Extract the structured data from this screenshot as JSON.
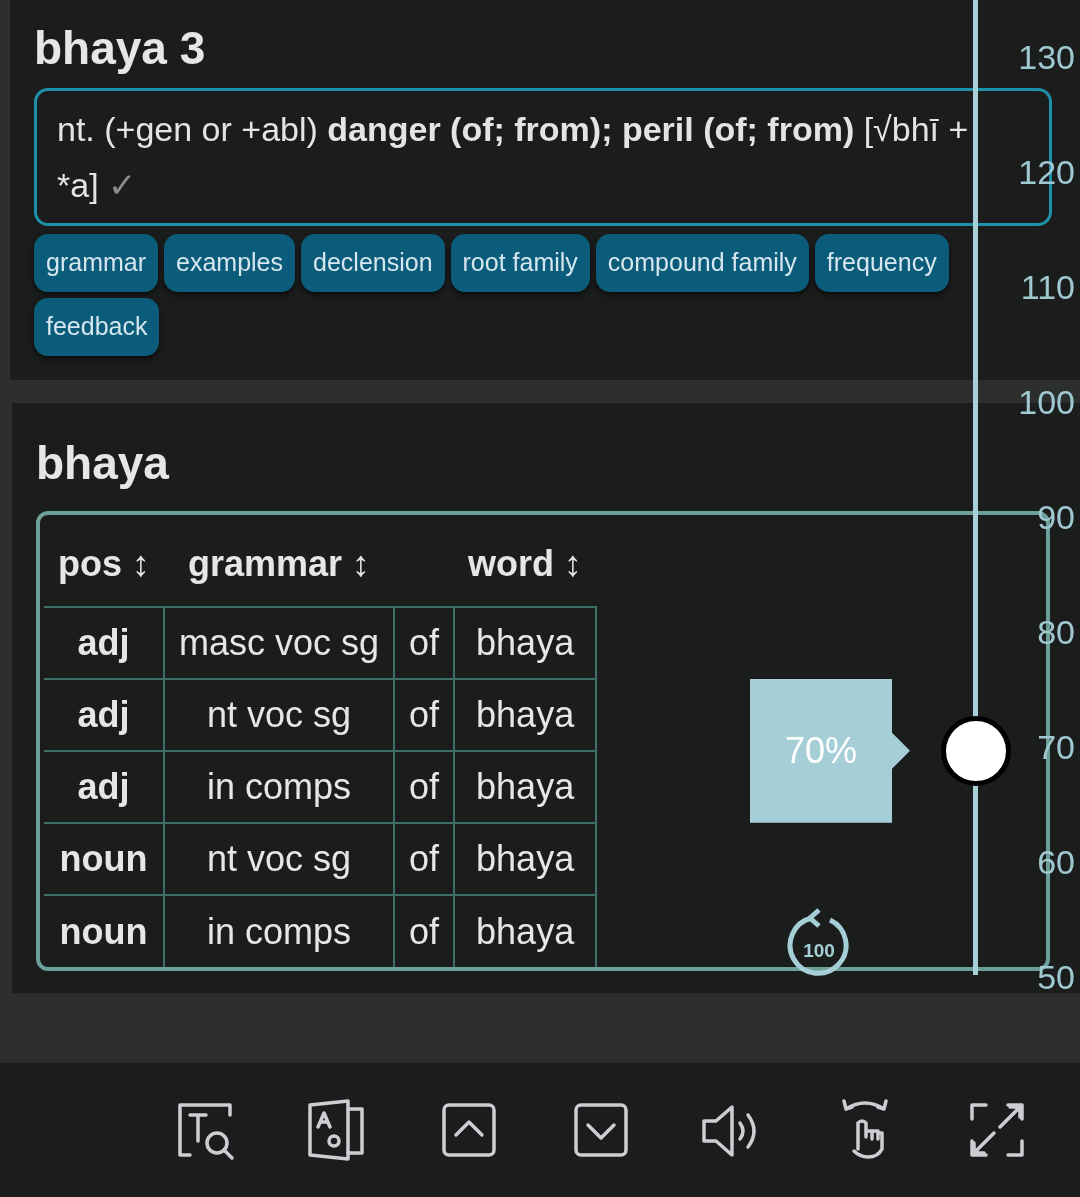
{
  "entries": [
    {
      "title": "bhaya 3",
      "definition": "nt. (+gen or +abl) **danger (of; from); peril (of; from)** [√bhī + *a]",
      "checkmark": "✓",
      "buttons": [
        "grammar",
        "examples",
        "declension",
        "root family",
        "compound family",
        "frequency",
        "feedback"
      ]
    },
    {
      "title": "bhaya",
      "table": {
        "columns": [
          "pos ↕",
          "grammar ↕",
          "",
          "word ↕"
        ],
        "rows": [
          [
            "adj",
            "masc voc sg",
            "of",
            "bhaya"
          ],
          [
            "adj",
            "nt voc sg",
            "of",
            "bhaya"
          ],
          [
            "adj",
            "in comps",
            "of",
            "bhaya"
          ],
          [
            "noun",
            "nt voc sg",
            "of",
            "bhaya"
          ],
          [
            "noun",
            "in comps",
            "of",
            "bhaya"
          ]
        ]
      }
    }
  ],
  "zoom_slider": {
    "ticks": [
      "130",
      "120",
      "110",
      "100",
      "90",
      "80",
      "70",
      "60",
      "50"
    ],
    "level": 0.23,
    "reading": "70%",
    "reset_label": "100"
  },
  "toolbar": [
    {
      "kind": "text-search"
    },
    {
      "kind": "translate"
    },
    {
      "kind": "up"
    },
    {
      "kind": "down"
    },
    {
      "kind": "speaker"
    },
    {
      "kind": "gesture"
    },
    {
      "kind": "expand"
    }
  ]
}
